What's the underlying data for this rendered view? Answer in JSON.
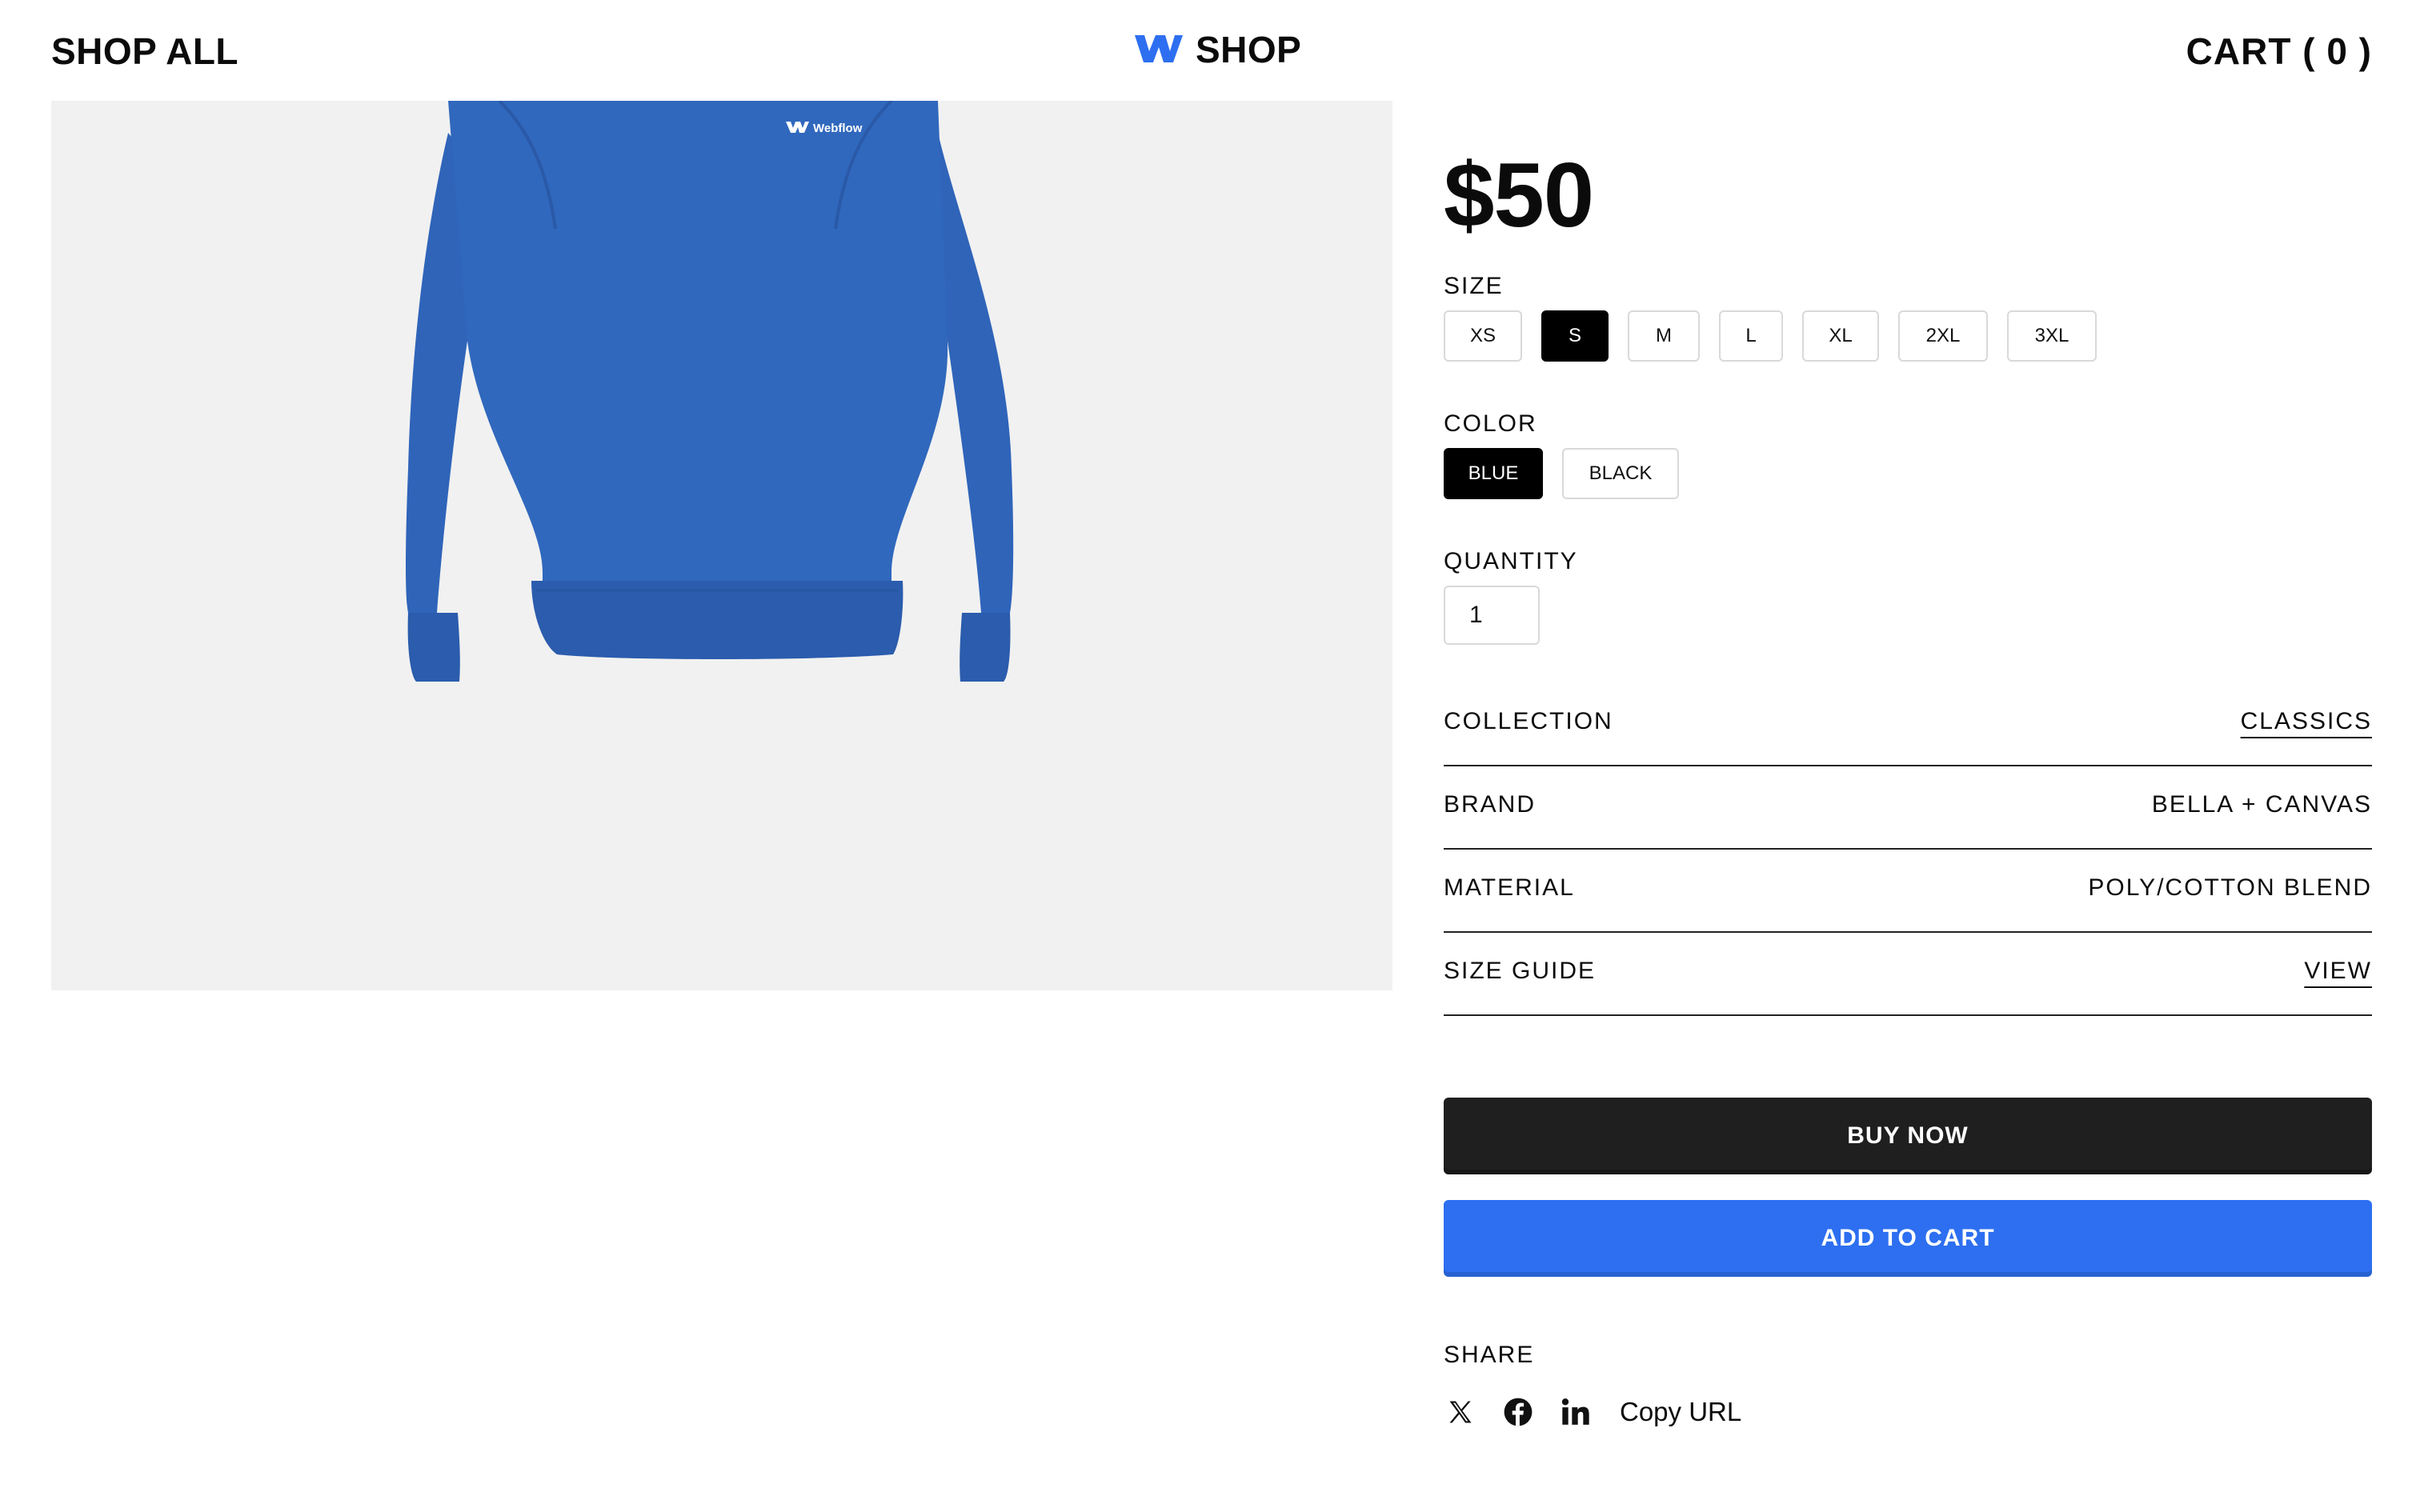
{
  "header": {
    "nav_left": "SHOP ALL",
    "brand": "SHOP",
    "cart_label": "CART",
    "cart_count": "( 0 )"
  },
  "product_image": {
    "logo_text": "Webflow",
    "garment_color": "#2f64b9"
  },
  "product": {
    "price": "$50",
    "size_label": "SIZE",
    "sizes": [
      "XS",
      "S",
      "M",
      "L",
      "XL",
      "2XL",
      "3XL"
    ],
    "selected_size": "S",
    "color_label": "COLOR",
    "colors": [
      "BLUE",
      "BLACK"
    ],
    "selected_color": "BLUE",
    "quantity_label": "QUANTITY",
    "quantity": "1"
  },
  "info_rows": [
    {
      "key": "COLLECTION",
      "value": "CLASSICS",
      "link": true
    },
    {
      "key": "BRAND",
      "value": "BELLA + CANVAS",
      "link": false
    },
    {
      "key": "MATERIAL",
      "value": "POLY/COTTON BLEND",
      "link": false
    },
    {
      "key": "SIZE GUIDE",
      "value": "VIEW",
      "link": true
    }
  ],
  "actions": {
    "buy_now": "BUY NOW",
    "add_to_cart": "ADD TO CART"
  },
  "share": {
    "label": "SHARE",
    "icons": [
      "x-icon",
      "facebook-icon",
      "linkedin-icon"
    ],
    "copy_url": "Copy URL"
  },
  "colors": {
    "accent": "#2d6ff0",
    "dark_button": "#1f1f1f",
    "image_bg": "#f1f1f1",
    "brand_logo": "#2d6ff0"
  }
}
